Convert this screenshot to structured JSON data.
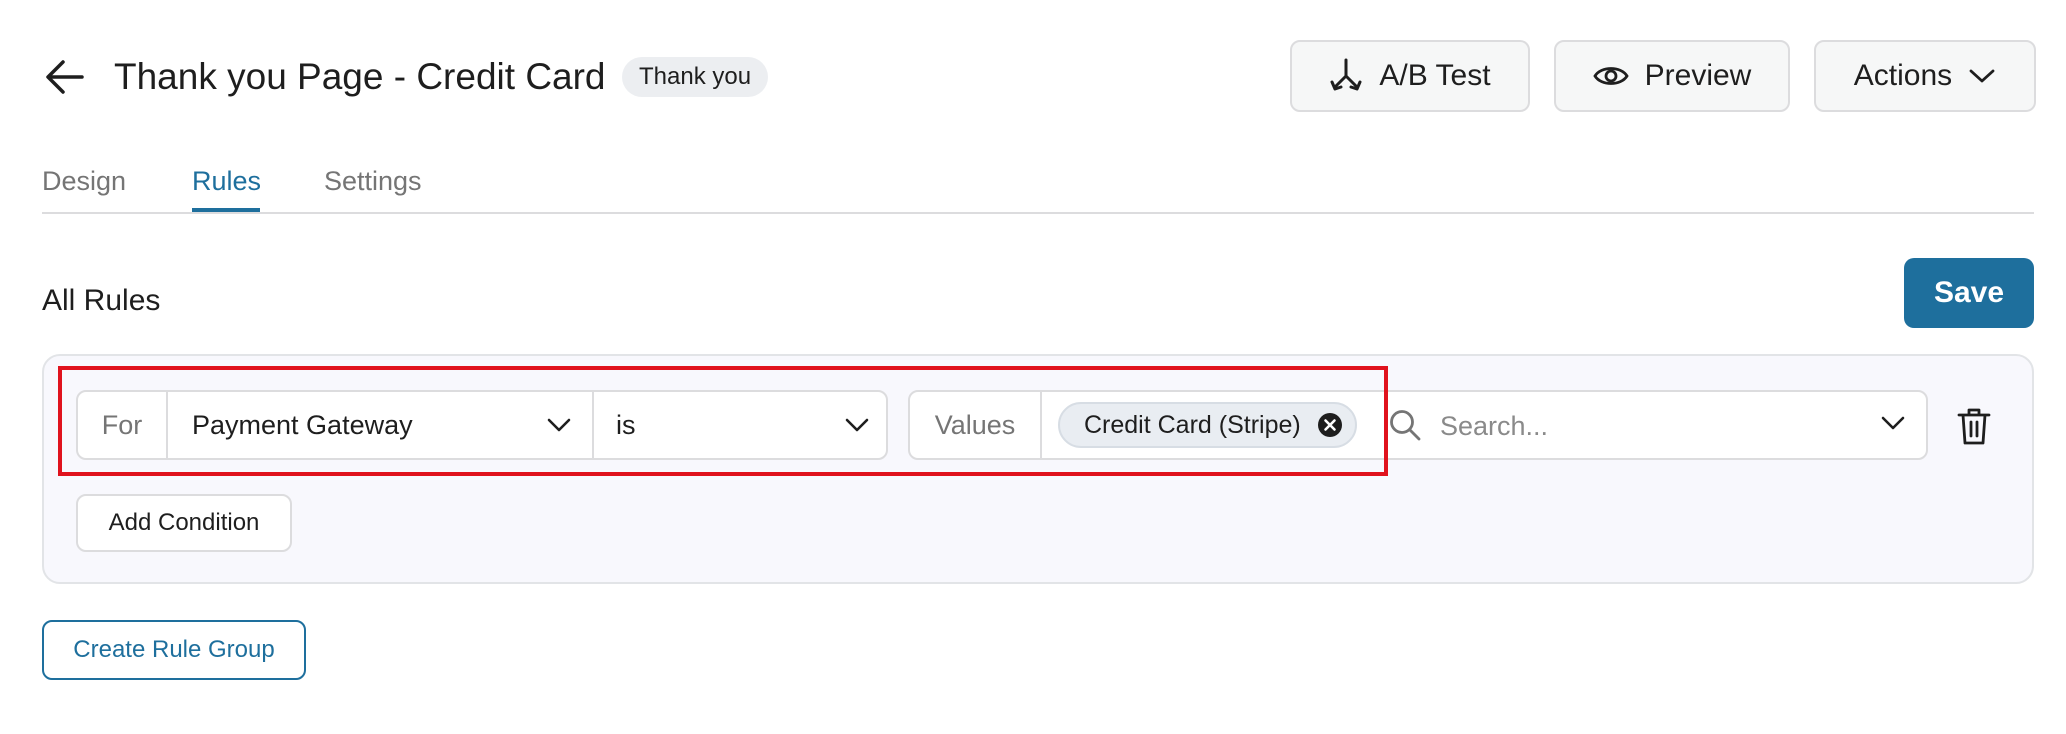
{
  "header": {
    "title": "Thank you Page - Credit Card",
    "badge": "Thank you",
    "buttons": {
      "ab_test": "A/B Test",
      "preview": "Preview",
      "actions": "Actions"
    }
  },
  "tabs": [
    {
      "label": "Design",
      "active": false
    },
    {
      "label": "Rules",
      "active": true
    },
    {
      "label": "Settings",
      "active": false
    }
  ],
  "rules": {
    "section_title": "All Rules",
    "save_label": "Save",
    "groups": [
      {
        "conditions": [
          {
            "for_label": "For",
            "field": "Payment Gateway",
            "operator": "is",
            "values_label": "Values",
            "selected_values": [
              "Credit Card (Stripe)"
            ],
            "search_placeholder": "Search..."
          }
        ],
        "add_condition_label": "Add Condition"
      }
    ],
    "create_group_label": "Create Rule Group"
  },
  "colors": {
    "accent": "#1e6f9d",
    "highlight": "#e0121d",
    "panel_bg": "#f8f8fd"
  },
  "icons": {
    "back": "arrow-left-icon",
    "ab_test": "split-arrows-icon",
    "preview": "eye-icon",
    "actions": "chevron-down-icon",
    "chip_remove": "close-circle-icon",
    "search": "search-icon",
    "delete": "trash-icon"
  }
}
